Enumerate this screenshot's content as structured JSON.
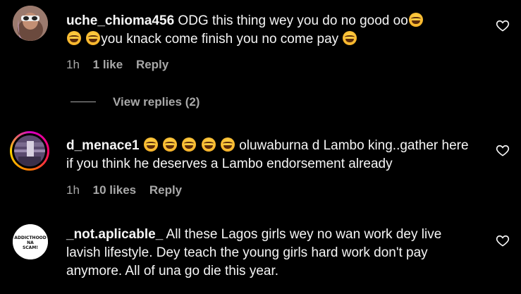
{
  "comments": [
    {
      "username": "uche_chioma456",
      "text_parts": [
        "ODG this thing wey you do no good oo",
        " ",
        "you knack come finish you no come pay "
      ],
      "time": "1h",
      "likes": "1 like",
      "reply": "Reply"
    },
    {
      "username": "d_menace1",
      "text_parts": [
        "oluwaburna d Lambo king..gather here if you think he deserves a Lambo endorsement already"
      ],
      "time": "1h",
      "likes": "10 likes",
      "reply": "Reply"
    },
    {
      "username": "_not.aplicable_",
      "text_parts": [
        "All these Lagos girls wey no wan work dey live lavish lifestyle. Dey teach the young girls hard work don't pay anymore. All of una go die this year."
      ],
      "avatar_text": "ADDICTHOOD NA SCAM!"
    }
  ],
  "view_replies": "View replies (2)",
  "icons": {
    "like": "heart-outline-icon",
    "emoji": "laughing-tears-emoji"
  }
}
